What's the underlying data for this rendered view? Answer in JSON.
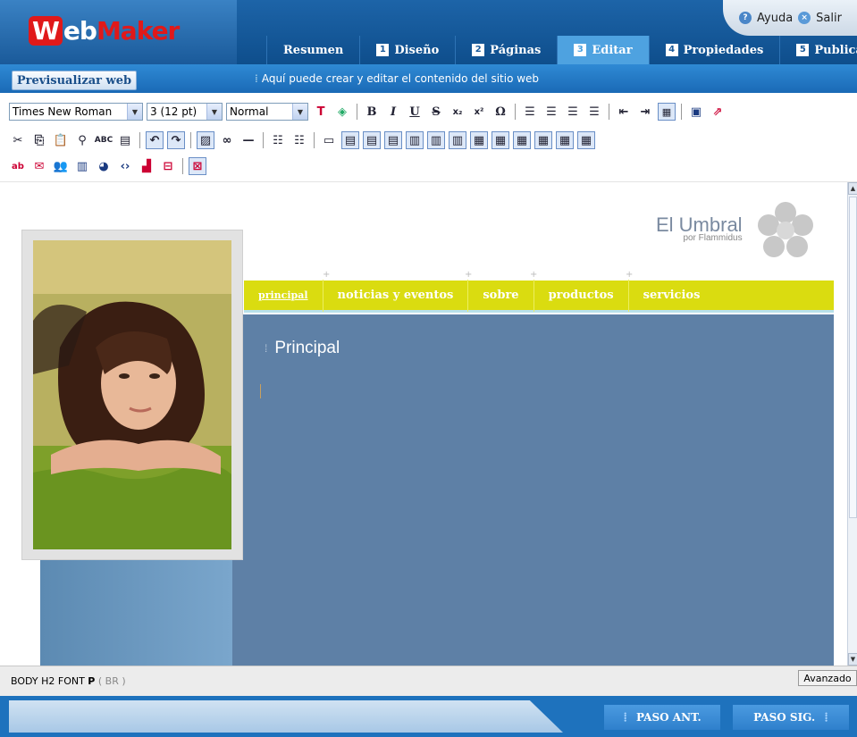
{
  "app": {
    "logo_w": "W",
    "logo_eb": "eb",
    "logo_maker": "Maker"
  },
  "toplinks": {
    "help": "Ayuda",
    "exit": "Salir"
  },
  "tabs": [
    {
      "num": "",
      "label": "Resumen",
      "active": false
    },
    {
      "num": "1",
      "label": "Diseño",
      "active": false
    },
    {
      "num": "2",
      "label": "Páginas",
      "active": false
    },
    {
      "num": "3",
      "label": "Editar",
      "active": true
    },
    {
      "num": "4",
      "label": "Propiedades",
      "active": false
    },
    {
      "num": "5",
      "label": "Publicar",
      "active": false
    }
  ],
  "infobar": {
    "preview_label": "Previsualizar web",
    "message": "Aquí puede crear y editar el contenido del sitio web"
  },
  "toolbar": {
    "font_family": "Times New Roman",
    "font_size": "3 (12 pt)",
    "block_format": "Normal"
  },
  "site": {
    "title": "El Umbral",
    "subtitle": "por Flammidus"
  },
  "nav": [
    "principal",
    "noticias y eventos",
    "sobre",
    "productos",
    "servicios"
  ],
  "page": {
    "heading": "Principal"
  },
  "status": {
    "path_main": "BODY H2 FONT",
    "path_bold": "P",
    "path_dim": "( BR )",
    "advanced_label": "Avanzado"
  },
  "footer": {
    "prev_label": "PASO ANT.",
    "next_label": "PASO SIG."
  },
  "colors": {
    "header_blue": "#1a5a9a",
    "active_tab": "#4ea2e0",
    "nav_yellow": "#dadc10",
    "content_blue": "#5e80a6"
  }
}
